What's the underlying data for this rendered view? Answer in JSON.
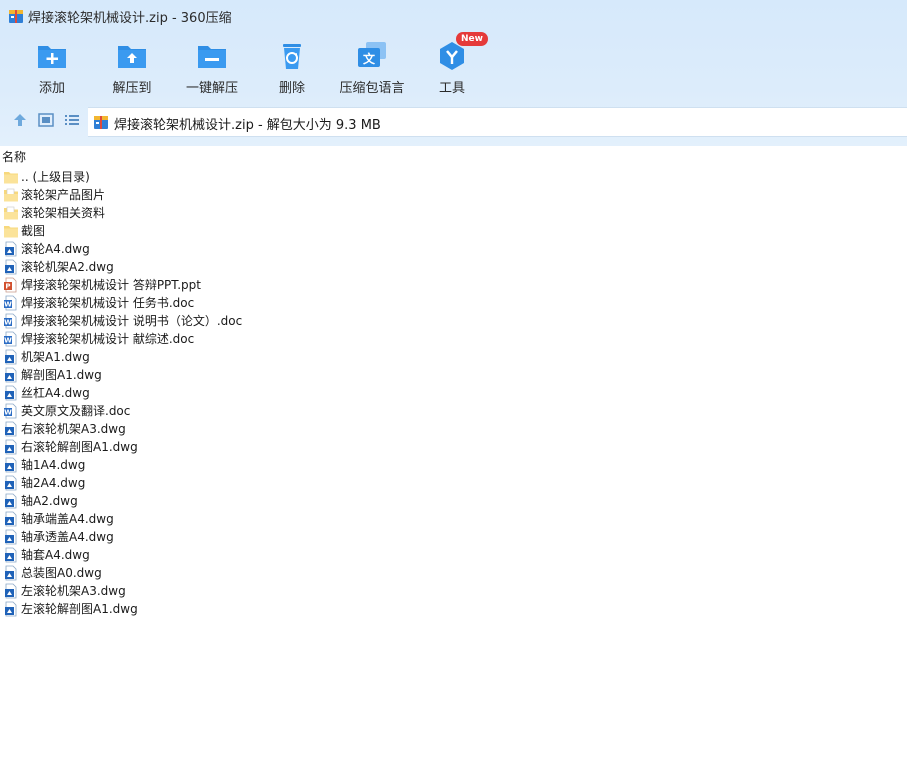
{
  "window": {
    "title": "焊接滚轮架机械设计.zip - 360压缩",
    "logo_icon": "archive-box-icon"
  },
  "toolbar": {
    "buttons": [
      {
        "label": "添加",
        "icon": "folder-add-icon"
      },
      {
        "label": "解压到",
        "icon": "folder-extract-icon"
      },
      {
        "label": "一键解压",
        "icon": "folder-oneclick-icon"
      },
      {
        "label": "删除",
        "icon": "recycle-bin-icon"
      },
      {
        "label": "压缩包语言",
        "icon": "translate-icon"
      },
      {
        "label": "工具",
        "icon": "tools-icon",
        "badge": "New"
      }
    ]
  },
  "nav": {
    "up_icon": "arrow-up-icon",
    "view_icon": "view-mode-icon",
    "list_icon": "list-view-icon"
  },
  "address": {
    "text": "焊接滚轮架机械设计.zip - 解包大小为 9.3 MB",
    "icon": "archive-box-icon"
  },
  "list": {
    "column_name": "名称",
    "files": [
      {
        "name": ".. (上级目录)",
        "type": "folder"
      },
      {
        "name": "滚轮架产品图片",
        "type": "folder-doc"
      },
      {
        "name": "滚轮架相关资料",
        "type": "folder-doc"
      },
      {
        "name": "截图",
        "type": "folder"
      },
      {
        "name": "滚轮A4.dwg",
        "type": "dwg"
      },
      {
        "name": "滚轮机架A2.dwg",
        "type": "dwg"
      },
      {
        "name": "焊接滚轮架机械设计 答辩PPT.ppt",
        "type": "ppt"
      },
      {
        "name": "焊接滚轮架机械设计 任务书.doc",
        "type": "doc"
      },
      {
        "name": "焊接滚轮架机械设计 说明书（论文）.doc",
        "type": "doc"
      },
      {
        "name": "焊接滚轮架机械设计 献综述.doc",
        "type": "doc"
      },
      {
        "name": "机架A1.dwg",
        "type": "dwg"
      },
      {
        "name": "解剖图A1.dwg",
        "type": "dwg"
      },
      {
        "name": "丝杠A4.dwg",
        "type": "dwg"
      },
      {
        "name": "英文原文及翻译.doc",
        "type": "doc"
      },
      {
        "name": "右滚轮机架A3.dwg",
        "type": "dwg"
      },
      {
        "name": "右滚轮解剖图A1.dwg",
        "type": "dwg"
      },
      {
        "name": "轴1A4.dwg",
        "type": "dwg"
      },
      {
        "name": "轴2A4.dwg",
        "type": "dwg"
      },
      {
        "name": "轴A2.dwg",
        "type": "dwg"
      },
      {
        "name": "轴承端盖A4.dwg",
        "type": "dwg"
      },
      {
        "name": "轴承透盖A4.dwg",
        "type": "dwg"
      },
      {
        "name": "轴套A4.dwg",
        "type": "dwg"
      },
      {
        "name": "总装图A0.dwg",
        "type": "dwg"
      },
      {
        "name": "左滚轮机架A3.dwg",
        "type": "dwg"
      },
      {
        "name": "左滚轮解剖图A1.dwg",
        "type": "dwg"
      }
    ]
  },
  "colors": {
    "accent": "#2f8ee5",
    "header_bg": "#d8eafb",
    "badge": "#e53a3a",
    "folder": "#f7d87c"
  }
}
